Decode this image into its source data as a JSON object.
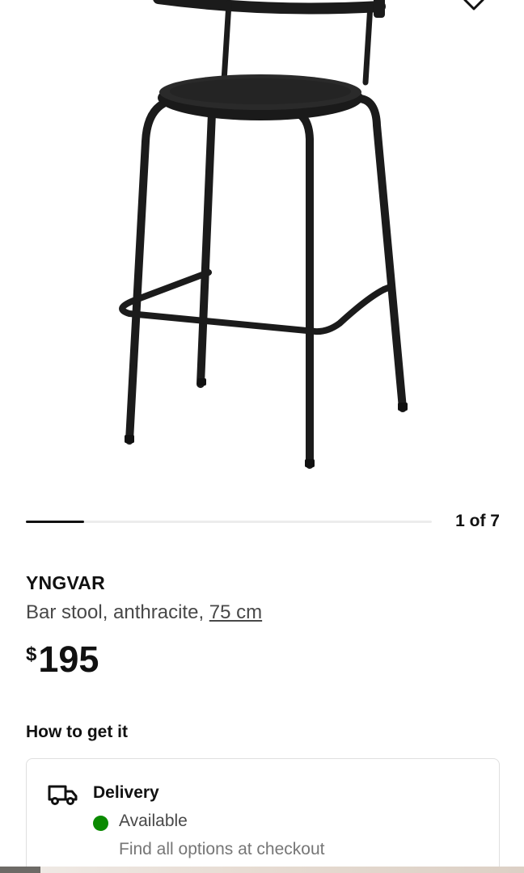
{
  "gallery": {
    "image_alt": "YNGVAR bar stool",
    "position_text": "1 of 7",
    "progress_fraction": 0.143
  },
  "wishlist": {
    "icon": "heart-icon"
  },
  "product": {
    "name": "YNGVAR",
    "description": "Bar stool, anthracite, ",
    "size": "75 cm",
    "currency": "$",
    "price": "195"
  },
  "how_to_get": {
    "heading": "How to get it",
    "delivery": {
      "icon": "truck-icon",
      "title": "Delivery",
      "status": "Available",
      "status_color": "#0a8a00",
      "options_text": "Find all options at checkout"
    }
  }
}
